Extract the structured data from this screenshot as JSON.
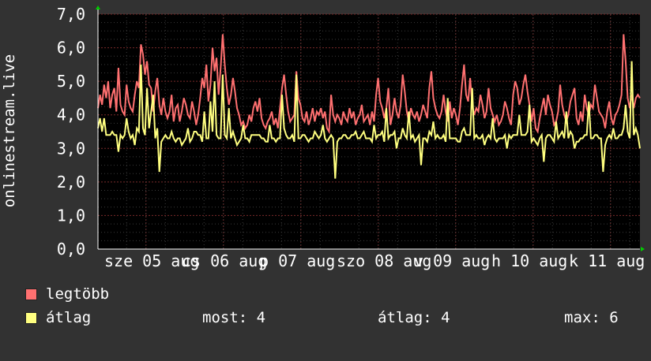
{
  "chart_data": {
    "type": "line",
    "ylabel": "onlinestream.live",
    "ylim": [
      0,
      7
    ],
    "y_ticks": [
      "0,0",
      "1,0",
      "2,0",
      "3,0",
      "4,0",
      "5,0",
      "6,0",
      "7,0"
    ],
    "x_ticks": [
      "sze 05 aug",
      "cs 06 aug",
      "p 07 aug",
      "szo 08 aug",
      "v 09 aug",
      "h 10 aug",
      "k 11 aug"
    ],
    "grid": true,
    "series": [
      {
        "name": "legtöbb",
        "color": "#ff7070",
        "values": [
          4.2,
          4.6,
          4.3,
          4.9,
          4.5,
          5.0,
          4.2,
          4.6,
          4.8,
          4.1,
          5.4,
          4.3,
          4.1,
          4.0,
          4.9,
          4.4,
          4.2,
          4.1,
          4.6,
          5.0,
          4.8,
          6.1,
          5.8,
          5.2,
          5.6,
          4.9,
          4.8,
          4.1,
          4.7,
          5.1,
          4.3,
          4.0,
          4.5,
          4.1,
          3.9,
          4.1,
          4.6,
          3.8,
          4.2,
          4.3,
          3.8,
          4.1,
          4.5,
          4.3,
          4.0,
          3.9,
          4.4,
          4.1,
          3.7,
          4.0,
          4.5,
          5.1,
          4.8,
          5.5,
          4.4,
          4.9,
          6.0,
          5.3,
          5.7,
          4.6,
          5.4,
          6.4,
          5.5,
          4.8,
          4.3,
          4.6,
          5.1,
          4.7,
          4.2,
          4.0,
          3.7,
          3.8,
          3.6,
          3.7,
          4.0,
          3.8,
          4.2,
          4.4,
          4.1,
          4.5,
          3.9,
          3.7,
          3.6,
          3.8,
          3.9,
          4.1,
          3.7,
          3.9,
          3.6,
          4.2,
          4.8,
          5.2,
          4.6,
          4.1,
          3.8,
          3.9,
          4.0,
          5.3,
          4.5,
          4.3,
          3.9,
          3.8,
          4.1,
          3.7,
          3.9,
          4.2,
          3.8,
          4.1,
          4.0,
          4.2,
          3.9,
          4.1,
          3.6,
          3.5,
          4.6,
          4.0,
          3.8,
          4.0,
          3.9,
          3.7,
          4.1,
          3.9,
          3.8,
          4.2,
          3.9,
          4.1,
          3.7,
          3.9,
          4.0,
          4.3,
          3.8,
          3.9,
          4.0,
          3.7,
          4.1,
          3.8,
          4.6,
          5.1,
          4.4,
          4.2,
          3.9,
          4.2,
          4.8,
          3.7,
          4.0,
          4.5,
          4.1,
          3.9,
          4.3,
          5.2,
          4.7,
          4.1,
          3.8,
          4.2,
          4.0,
          3.9,
          4.1,
          3.8,
          4.0,
          4.3,
          4.1,
          3.9,
          4.8,
          5.3,
          4.5,
          4.2,
          4.0,
          3.9,
          4.1,
          4.6,
          4.1,
          3.8,
          4.4,
          3.9,
          4.2,
          4.0,
          3.7,
          4.2,
          4.9,
          5.5,
          4.6,
          4.4,
          5.1,
          4.3,
          4.0,
          4.2,
          4.1,
          4.6,
          4.3,
          3.9,
          4.1,
          4.8,
          4.2,
          4.0,
          3.8,
          4.0,
          3.7,
          3.8,
          4.0,
          4.4,
          4.2,
          3.9,
          3.7,
          4.6,
          5.0,
          4.8,
          4.3,
          4.5,
          4.9,
          5.2,
          4.7,
          4.3,
          3.8,
          4.2,
          3.6,
          3.5,
          3.9,
          4.2,
          4.5,
          4.0,
          4.6,
          4.3,
          4.1,
          3.7,
          3.8,
          4.1,
          4.9,
          4.3,
          4.0,
          3.8,
          4.0,
          4.4,
          4.6,
          4.8,
          3.9,
          3.7,
          4.1,
          3.8,
          4.6,
          4.2,
          4.0,
          4.3,
          4.2,
          4.9,
          4.5,
          4.1,
          4.0,
          3.9,
          3.6,
          4.1,
          4.4,
          3.9,
          3.7,
          4.0,
          4.1,
          4.3,
          4.6,
          6.4,
          5.6,
          4.5,
          4.2,
          4.6,
          4.2,
          4.5,
          4.6,
          4.5
        ]
      },
      {
        "name": "átlag",
        "color": "#ffff80",
        "values": [
          3.6,
          3.9,
          3.5,
          3.5,
          3.4,
          3.4,
          3.4,
          3.5,
          3.4,
          3.4,
          3.0,
          3.4,
          3.3,
          3.4,
          4.2,
          3.5,
          3.3,
          3.4,
          3.6,
          3.6,
          3.5,
          3.9,
          3.6,
          3.4,
          3.5,
          3.6,
          4.1,
          3.5,
          3.3,
          3.6,
          3.2,
          3.2,
          3.3,
          3.4,
          3.3,
          3.3,
          3.5,
          3.3,
          3.2,
          3.3,
          3.3,
          3.4,
          3.2,
          3.3,
          3.6,
          3.2,
          3.3,
          3.5,
          3.3,
          3.4,
          3.4,
          3.2,
          3.2,
          3.3,
          3.3,
          3.4,
          3.5,
          3.6,
          3.4,
          3.3,
          3.3,
          3.6,
          3.4,
          3.3,
          3.2,
          3.3,
          3.5,
          3.3,
          3.1,
          3.2,
          3.3,
          3.4,
          3.3,
          3.3,
          3.2,
          3.3,
          3.4,
          3.4,
          3.4,
          3.4,
          3.3,
          3.3,
          3.2,
          3.2,
          3.3,
          3.3,
          3.3,
          3.2,
          3.3,
          3.3,
          3.4,
          3.6,
          3.4,
          3.3,
          3.3,
          3.4,
          3.2,
          3.5,
          3.3,
          3.3,
          3.4,
          3.4,
          3.3,
          3.2,
          3.3,
          3.3,
          3.5,
          3.4,
          3.3,
          3.4,
          3.3,
          3.3,
          3.2,
          3.3,
          3.4,
          3.3,
          3.3,
          3.2,
          3.3,
          3.3,
          3.4,
          3.4,
          3.3,
          3.3,
          3.4,
          3.4,
          3.3,
          3.3,
          3.3,
          3.4,
          3.5,
          3.3,
          3.3,
          3.3,
          3.2,
          3.3,
          3.3,
          3.4,
          3.4,
          3.5,
          3.2,
          3.2,
          3.3,
          3.4,
          3.4,
          3.5,
          3.3,
          3.3,
          3.3,
          3.6,
          3.4,
          3.3,
          3.2,
          3.3,
          3.4,
          3.2,
          3.3,
          3.4,
          3.3,
          3.3,
          3.3,
          3.2,
          3.5,
          3.4,
          3.3,
          3.3,
          3.4,
          3.3,
          3.3,
          3.4,
          3.2,
          3.1,
          3.3,
          3.3,
          3.3,
          3.3,
          3.2,
          3.2,
          3.4,
          3.6,
          3.4,
          3.4,
          3.4,
          3.4,
          3.3,
          3.4,
          3.3,
          3.3,
          3.4,
          3.2,
          3.3,
          3.4,
          3.3,
          3.4,
          3.3,
          3.2,
          3.3,
          3.3,
          3.3,
          3.4,
          3.3,
          3.4,
          3.3,
          3.4,
          3.4,
          3.4,
          3.4,
          3.4,
          3.4,
          3.4,
          3.5,
          3.3,
          3.2,
          3.3,
          3.2,
          3.1,
          3.3,
          3.4,
          3.3,
          3.3,
          3.4,
          3.4,
          3.3,
          3.2,
          3.3,
          3.3,
          3.4,
          3.5,
          3.3,
          3.2,
          3.3,
          3.5,
          3.4,
          3.4,
          3.2,
          3.2,
          3.3,
          3.3,
          3.4,
          3.4,
          3.4,
          3.3,
          3.3,
          3.4,
          3.4,
          3.3,
          3.3,
          3.3,
          3.1,
          3.3,
          3.4,
          3.3,
          3.2,
          3.3,
          3.3,
          3.4,
          3.4,
          3.6,
          4.2,
          3.5,
          3.3,
          3.4,
          3.4,
          3.6,
          3.4,
          3.3
        ],
        "spikes": [
          {
            "i": 3,
            "v": 3.9
          },
          {
            "i": 10,
            "v": 2.9
          },
          {
            "i": 14,
            "v": 3.9
          },
          {
            "i": 18,
            "v": 3.1
          },
          {
            "i": 21,
            "v": 5.5
          },
          {
            "i": 24,
            "v": 4.8
          },
          {
            "i": 27,
            "v": 4.6
          },
          {
            "i": 30,
            "v": 2.3
          },
          {
            "i": 41,
            "v": 3.1
          },
          {
            "i": 48,
            "v": 3.5
          },
          {
            "i": 52,
            "v": 4.1
          },
          {
            "i": 55,
            "v": 4.4
          },
          {
            "i": 57,
            "v": 5.0
          },
          {
            "i": 61,
            "v": 5.2
          },
          {
            "i": 64,
            "v": 4.2
          },
          {
            "i": 71,
            "v": 3.7
          },
          {
            "i": 75,
            "v": 3.4
          },
          {
            "i": 84,
            "v": 3.7
          },
          {
            "i": 90,
            "v": 4.6
          },
          {
            "i": 97,
            "v": 5.2
          },
          {
            "i": 103,
            "v": 3.2
          },
          {
            "i": 110,
            "v": 3.7
          },
          {
            "i": 116,
            "v": 2.1
          },
          {
            "i": 126,
            "v": 3.5
          },
          {
            "i": 135,
            "v": 3.7
          },
          {
            "i": 141,
            "v": 4.2
          },
          {
            "i": 146,
            "v": 3.0
          },
          {
            "i": 152,
            "v": 4.1
          },
          {
            "i": 158,
            "v": 2.5
          },
          {
            "i": 164,
            "v": 3.8
          },
          {
            "i": 171,
            "v": 4.5
          },
          {
            "i": 178,
            "v": 3.5
          },
          {
            "i": 183,
            "v": 4.8
          },
          {
            "i": 189,
            "v": 3.1
          },
          {
            "i": 193,
            "v": 3.9
          },
          {
            "i": 200,
            "v": 3.0
          },
          {
            "i": 206,
            "v": 4.0
          },
          {
            "i": 211,
            "v": 4.3
          },
          {
            "i": 218,
            "v": 2.6
          },
          {
            "i": 224,
            "v": 3.8
          },
          {
            "i": 229,
            "v": 4.1
          },
          {
            "i": 233,
            "v": 3.0
          },
          {
            "i": 240,
            "v": 4.4
          },
          {
            "i": 247,
            "v": 2.3
          },
          {
            "i": 252,
            "v": 3.6
          },
          {
            "i": 258,
            "v": 4.3
          },
          {
            "i": 261,
            "v": 5.6
          },
          {
            "i": 265,
            "v": 3.0
          }
        ]
      }
    ]
  },
  "legend": [
    {
      "label": "legtöbb",
      "color": "#ff7070"
    },
    {
      "label": "átlag",
      "color": "#ffff80"
    }
  ],
  "stats": {
    "most": "most: 4",
    "atlag": "átlag: 4",
    "max": "max: 6"
  }
}
